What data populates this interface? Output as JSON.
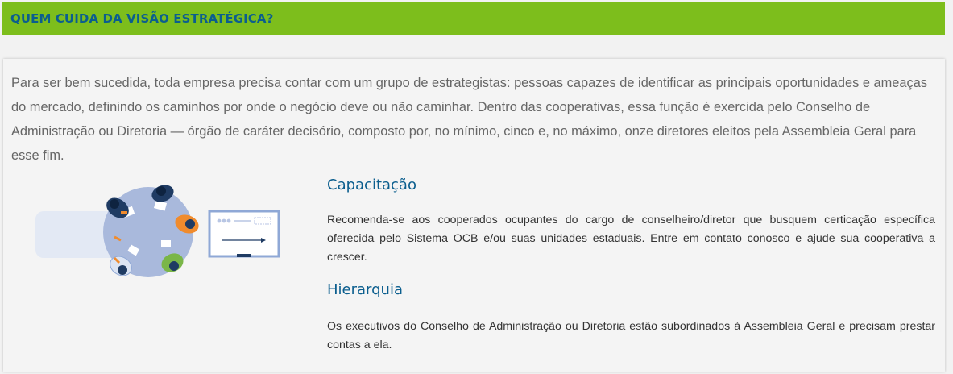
{
  "header": {
    "title": "QUEM CUIDA DA VISÃO ESTRATÉGICA?"
  },
  "intro": {
    "text": "Para ser bem sucedida, toda empresa precisa contar com um grupo de estrategistas: pessoas capazes de identificar as principais oportunidades e ameaças do mercado, definindo os caminhos por onde o negócio deve ou não caminhar. Dentro das cooperativas, essa função é exercida pelo Conselho de Administração ou Diretoria — órgão de caráter decisório, composto por, no mínimo, cinco e, no máximo, onze diretores eleitos pela Assembleia Geral para esse fim."
  },
  "sections": [
    {
      "title": "Capacitação",
      "text": "Recomenda-se aos cooperados ocupantes do cargo de conselheiro/diretor que busquem certicação específica oferecida pelo Sistema OCB e/ou suas unidades estaduais. Entre em contato conosco e ajude sua cooperativa a crescer."
    },
    {
      "title": "Hierarquia",
      "text": "Os executivos do Conselho de Administração ou Diretoria estão subordinados à Assembleia Geral e precisam prestar contas a ela."
    }
  ],
  "illustration": {
    "icon": "meeting-table-illustration",
    "colors": {
      "table": "#a9b9dc",
      "board": "#8fa8d6",
      "navy": "#1f3b63",
      "orange": "#f08b2d",
      "green": "#7ab648",
      "light": "#dce4f3"
    }
  },
  "theme": {
    "accent": "#7dbe1c",
    "title_color": "#0b5e8e",
    "text_color": "#666666",
    "body_color": "#333333"
  }
}
